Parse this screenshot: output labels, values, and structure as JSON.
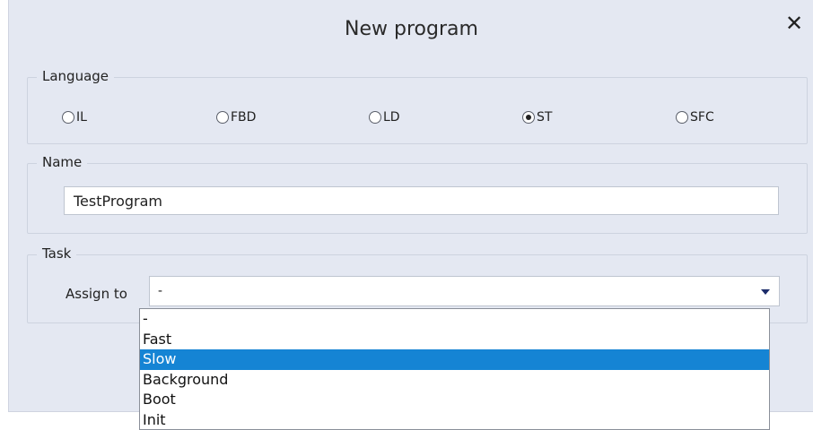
{
  "dialog": {
    "title": "New program",
    "close_glyph": "✕"
  },
  "language": {
    "legend": "Language",
    "options": [
      {
        "label": "IL",
        "checked": false
      },
      {
        "label": "FBD",
        "checked": false
      },
      {
        "label": "LD",
        "checked": false
      },
      {
        "label": "ST",
        "checked": true
      },
      {
        "label": "SFC",
        "checked": false
      }
    ]
  },
  "name": {
    "legend": "Name",
    "value": "TestProgram"
  },
  "task": {
    "legend": "Task",
    "assign_label": "Assign to",
    "selected_value": "-",
    "options": [
      "-",
      "Fast",
      "Slow",
      "Background",
      "Boot",
      "Init"
    ],
    "highlighted": "Slow"
  },
  "colors": {
    "dialog_bg": "#e4e8f2",
    "highlight": "#1584d4",
    "dropdown_arrow": "#1c2c6a"
  }
}
